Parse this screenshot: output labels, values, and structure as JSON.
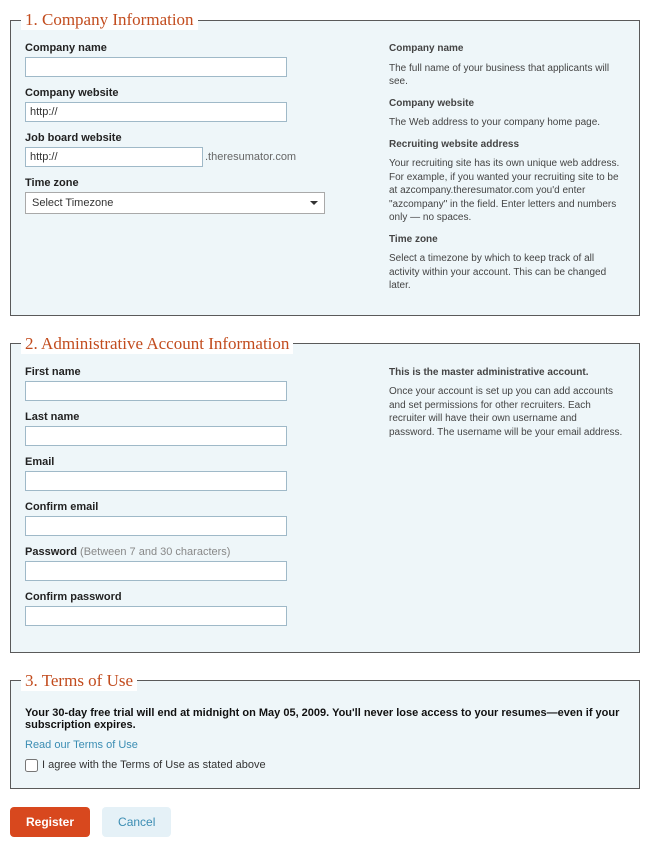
{
  "section1": {
    "legend": "1. Company Information",
    "fields": {
      "company_name_label": "Company name",
      "company_name_value": "",
      "company_website_label": "Company website",
      "company_website_value": "http://",
      "job_board_label": "Job board website",
      "job_board_value": "http://",
      "job_board_suffix": ".theresumator.com",
      "timezone_label": "Time zone",
      "timezone_selected": "Select Timezone"
    },
    "help": {
      "h1": "Company name",
      "t1": "The full name of your business that applicants will see.",
      "h2": "Company website",
      "t2": "The Web address to your company home page.",
      "h3": "Recruiting website address",
      "t3": "Your recruiting site has its own unique web address. For example, if you wanted your recruiting site to be at azcompany.theresumator.com you'd enter \"azcompany\" in the field. Enter letters and numbers only — no spaces.",
      "h4": "Time zone",
      "t4": "Select a timezone by which to keep track of all activity within your account. This can be changed later."
    }
  },
  "section2": {
    "legend": "2. Administrative Account Information",
    "fields": {
      "first_name_label": "First name",
      "last_name_label": "Last name",
      "email_label": "Email",
      "confirm_email_label": "Confirm email",
      "password_label": "Password",
      "password_hint": "(Between 7 and 30 characters)",
      "confirm_password_label": "Confirm password"
    },
    "help": {
      "h1": "This is the master administrative account.",
      "t1": "Once your account is set up you can add accounts and set permissions for other recruiters. Each recruiter will have their own username and password. The username will be your email address."
    }
  },
  "section3": {
    "legend": "3. Terms of Use",
    "trial_text": "Your 30-day free trial will end at midnight on May 05, 2009. You'll never lose access to your resumes—even if your subscription expires.",
    "terms_link": "Read our Terms of Use",
    "agree_label": "I agree with the Terms of Use as stated above"
  },
  "buttons": {
    "register": "Register",
    "cancel": "Cancel"
  }
}
